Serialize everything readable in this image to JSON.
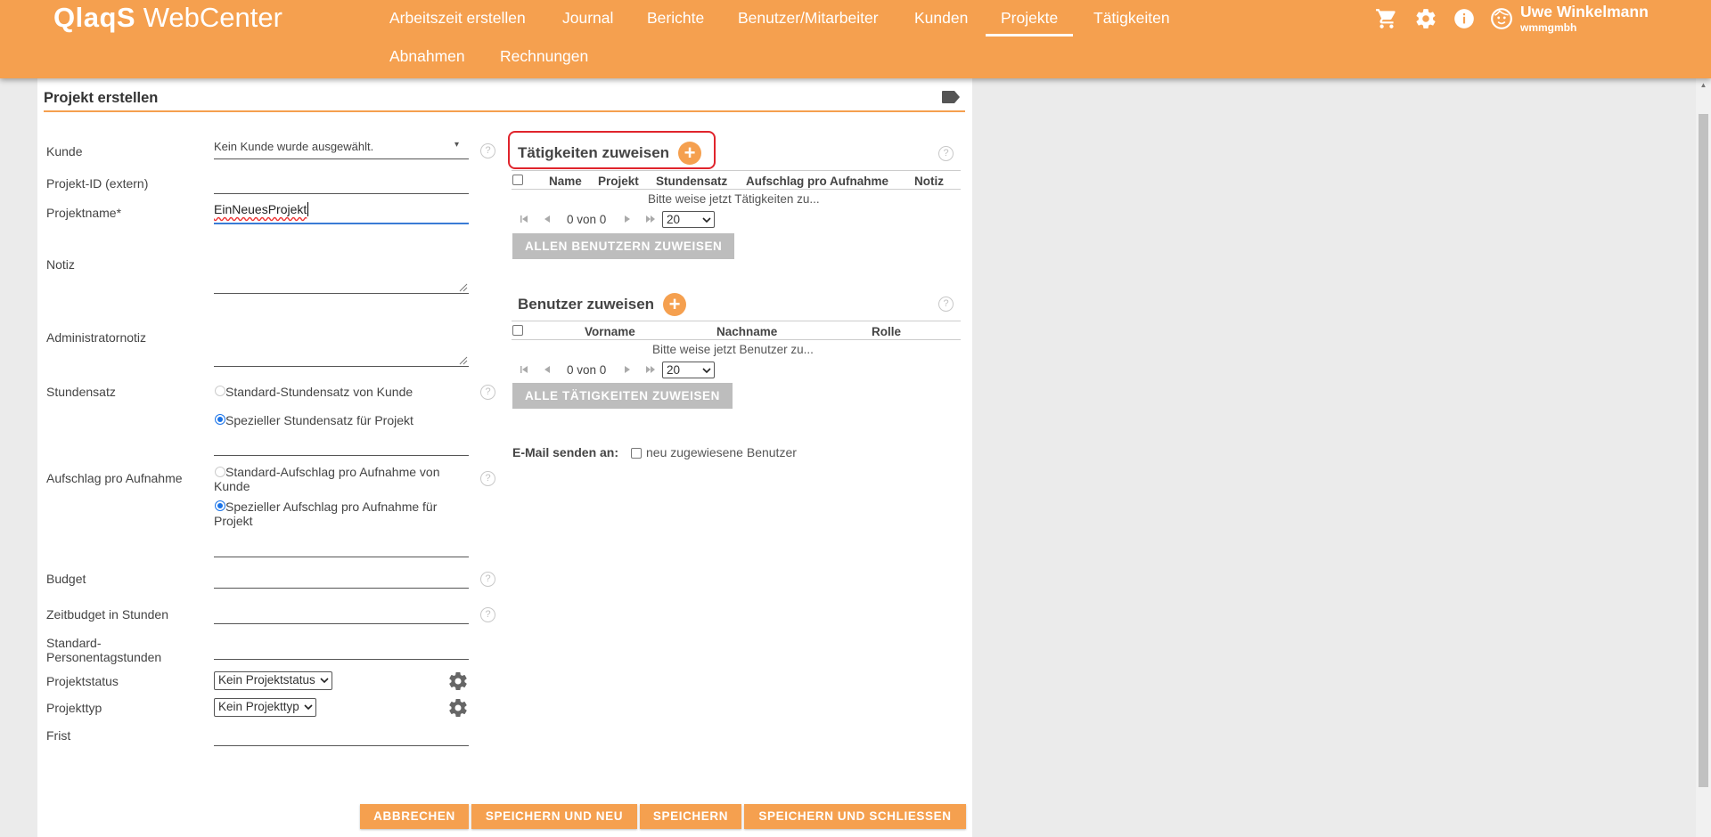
{
  "header": {
    "logo_bold": "QlaqS",
    "logo_rest": " WebCenter",
    "nav": [
      "Arbeitszeit erstellen",
      "Journal",
      "Berichte",
      "Benutzer/Mitarbeiter",
      "Kunden",
      "Projekte",
      "Tätigkeiten",
      "Abnahmen",
      "Rechnungen"
    ],
    "active_nav": "Projekte",
    "user_name": "Uwe Winkelmann",
    "user_org": "wmmgmbh",
    "icons": [
      "cart-icon",
      "gear-icon",
      "info-icon",
      "user-avatar-icon"
    ]
  },
  "form": {
    "title": "Projekt erstellen",
    "kunde_label": "Kunde",
    "kunde_value": "Kein Kunde wurde ausgewählt.",
    "projekt_id_label": "Projekt-ID (extern)",
    "projektname_label": "Projektname*",
    "projektname_value": "EinNeuesProjekt",
    "notiz_label": "Notiz",
    "admin_notiz_label": "Administratornotiz",
    "stundensatz_label": "Stundensatz",
    "stundensatz_opt1": "Standard-Stundensatz von Kunde",
    "stundensatz_opt2": "Spezieller Stundensatz für Projekt",
    "aufschlag_label": "Aufschlag pro Aufnahme",
    "aufschlag_opt1": "Standard-Aufschlag pro Aufnahme von Kunde",
    "aufschlag_opt2": "Spezieller Aufschlag pro Aufnahme für Projekt",
    "budget_label": "Budget",
    "zeitbudget_label": "Zeitbudget in Stunden",
    "personentage_label": "Standard-Personentagstunden",
    "projektstatus_label": "Projektstatus",
    "projektstatus_value": "Kein Projektstatus",
    "projekttyp_label": "Projekttyp",
    "projekttyp_value": "Kein Projekttyp",
    "frist_label": "Frist"
  },
  "taetigkeiten": {
    "title": "Tätigkeiten zuweisen",
    "columns": [
      "Name",
      "Projekt",
      "Stundensatz",
      "Aufschlag pro Aufnahme",
      "Notiz"
    ],
    "empty": "Bitte weise jetzt Tätigkeiten zu...",
    "pager_text": "0 von 0",
    "page_size": "20",
    "assign_all": "ALLEN BENUTZERN ZUWEISEN"
  },
  "benutzer": {
    "title": "Benutzer zuweisen",
    "columns": [
      "Vorname",
      "Nachname",
      "Rolle"
    ],
    "empty": "Bitte weise jetzt Benutzer zu...",
    "pager_text": "0 von 0",
    "page_size": "20",
    "assign_all": "ALLE TÄTIGKEITEN ZUWEISEN"
  },
  "email": {
    "label": "E-Mail senden an:",
    "option": "neu zugewiesene Benutzer"
  },
  "actions": {
    "cancel": "ABBRECHEN",
    "save_new": "SPEICHERN UND NEU",
    "save": "SPEICHERN",
    "save_close": "SPEICHERN UND SCHLIESSEN"
  },
  "colors": {
    "accent": "#f5a04f",
    "highlight": "#e0242c",
    "disabled_button": "#bdbdbd"
  }
}
